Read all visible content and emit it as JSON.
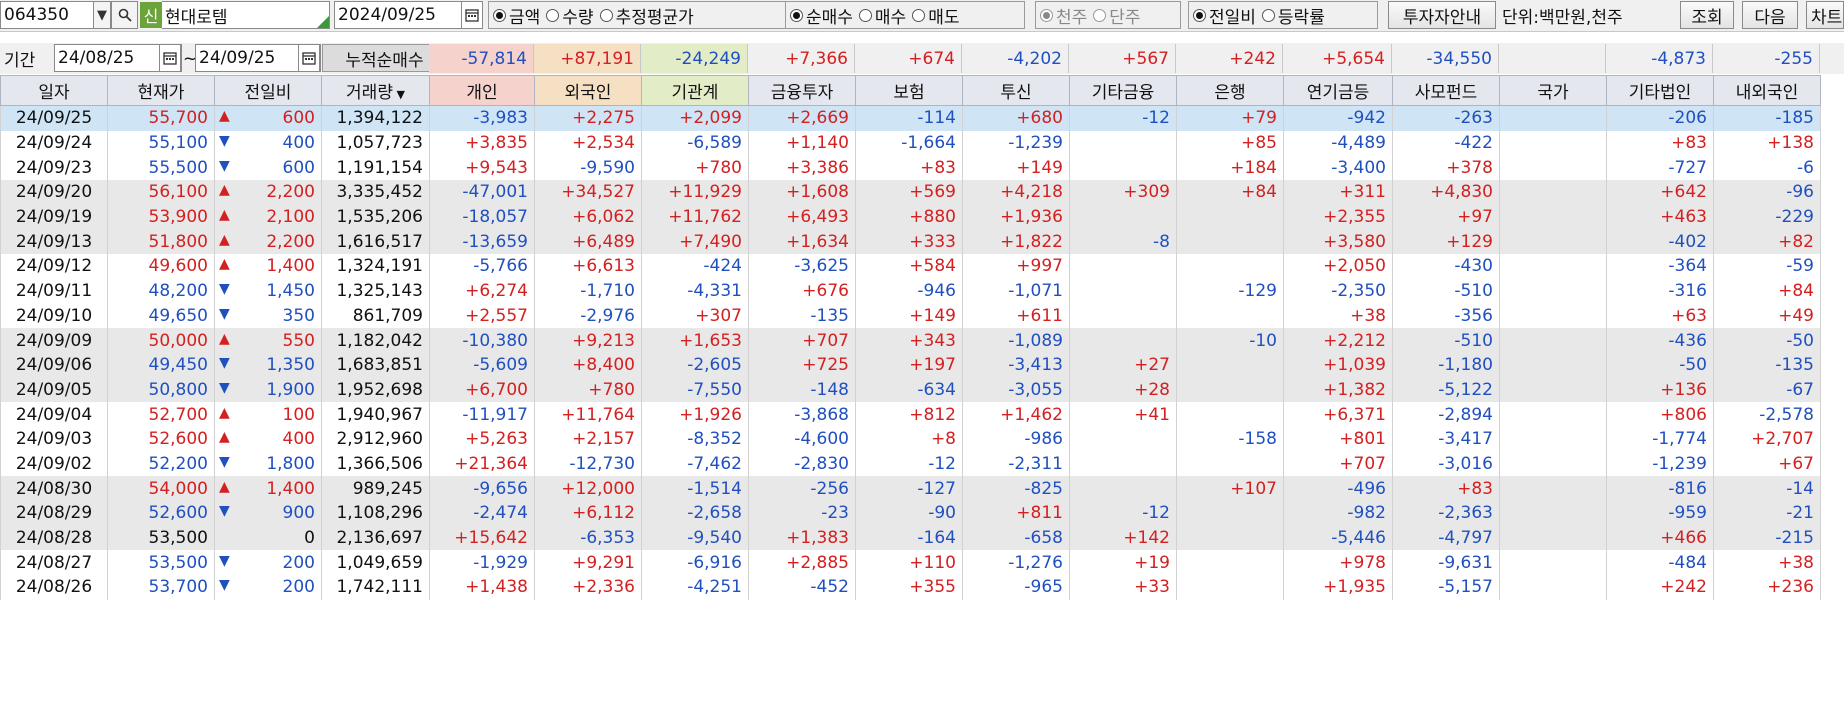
{
  "toolbar": {
    "code": "064350",
    "new_badge": "신",
    "name": "현대로템",
    "date": "2024/09/25",
    "unit_options": [
      "금액",
      "수량",
      "추정평균가"
    ],
    "trade_options": [
      "순매수",
      "매수",
      "매도"
    ],
    "scale_options": [
      "천주",
      "단주"
    ],
    "compare_options": [
      "전일비",
      "등락률"
    ],
    "investor_guide": "투자자안내",
    "units_label": "단위:백만원,천주",
    "search_btn": "조회",
    "next_btn": "다음",
    "chart_btn": "차트"
  },
  "period": {
    "label": "기간",
    "from": "24/08/25",
    "tilde": "~",
    "to": "24/09/25",
    "cum_label": "누적순매수"
  },
  "cumulative": [
    "-57,814",
    "+87,191",
    "-24,249",
    "+7,366",
    "+674",
    "-4,202",
    "+567",
    "+242",
    "+5,654",
    "-34,550",
    "",
    "-4,873",
    "-255"
  ],
  "columns": [
    "일자",
    "현재가",
    "전일비",
    "거래량",
    "개인",
    "외국인",
    "기관계",
    "금융투자",
    "보험",
    "투신",
    "기타금융",
    "은행",
    "연기금등",
    "사모펀드",
    "국가",
    "기타법인",
    "내외국인"
  ],
  "colors": {
    "up": "#d42020",
    "down": "#2050c0",
    "personal_bg": "#f6d2cc",
    "foreign_bg": "#f6e0c4",
    "inst_bg": "#e2ecc6"
  },
  "rows": [
    [
      "24/09/25",
      "55,700",
      "up",
      "600",
      "1,394,122",
      "-3,983",
      "+2,275",
      "+2,099",
      "+2,669",
      "-114",
      "+680",
      "-12",
      "+79",
      "-942",
      "-263",
      "",
      "-206",
      "-185"
    ],
    [
      "24/09/24",
      "55,100",
      "dn",
      "400",
      "1,057,723",
      "+3,835",
      "+2,534",
      "-6,589",
      "+1,140",
      "-1,664",
      "-1,239",
      "",
      "+85",
      "-4,489",
      "-422",
      "",
      "+83",
      "+138"
    ],
    [
      "24/09/23",
      "55,500",
      "dn",
      "600",
      "1,191,154",
      "+9,543",
      "-9,590",
      "+780",
      "+3,386",
      "+83",
      "+149",
      "",
      "+184",
      "-3,400",
      "+378",
      "",
      "-727",
      "-6"
    ],
    [
      "24/09/20",
      "56,100",
      "up",
      "2,200",
      "3,335,452",
      "-47,001",
      "+34,527",
      "+11,929",
      "+1,608",
      "+569",
      "+4,218",
      "+309",
      "+84",
      "+311",
      "+4,830",
      "",
      "+642",
      "-96"
    ],
    [
      "24/09/19",
      "53,900",
      "up",
      "2,100",
      "1,535,206",
      "-18,057",
      "+6,062",
      "+11,762",
      "+6,493",
      "+880",
      "+1,936",
      "",
      "",
      "+2,355",
      "+97",
      "",
      "+463",
      "-229"
    ],
    [
      "24/09/13",
      "51,800",
      "up",
      "2,200",
      "1,616,517",
      "-13,659",
      "+6,489",
      "+7,490",
      "+1,634",
      "+333",
      "+1,822",
      "-8",
      "",
      "+3,580",
      "+129",
      "",
      "-402",
      "+82"
    ],
    [
      "24/09/12",
      "49,600",
      "up",
      "1,400",
      "1,324,191",
      "-5,766",
      "+6,613",
      "-424",
      "-3,625",
      "+584",
      "+997",
      "",
      "",
      "+2,050",
      "-430",
      "",
      "-364",
      "-59"
    ],
    [
      "24/09/11",
      "48,200",
      "dn",
      "1,450",
      "1,325,143",
      "+6,274",
      "-1,710",
      "-4,331",
      "+676",
      "-946",
      "-1,071",
      "",
      "-129",
      "-2,350",
      "-510",
      "",
      "-316",
      "+84"
    ],
    [
      "24/09/10",
      "49,650",
      "dn",
      "350",
      "861,709",
      "+2,557",
      "-2,976",
      "+307",
      "-135",
      "+149",
      "+611",
      "",
      "",
      "+38",
      "-356",
      "",
      "+63",
      "+49"
    ],
    [
      "24/09/09",
      "50,000",
      "up",
      "550",
      "1,182,042",
      "-10,380",
      "+9,213",
      "+1,653",
      "+707",
      "+343",
      "-1,089",
      "",
      "-10",
      "+2,212",
      "-510",
      "",
      "-436",
      "-50"
    ],
    [
      "24/09/06",
      "49,450",
      "dn",
      "1,350",
      "1,683,851",
      "-5,609",
      "+8,400",
      "-2,605",
      "+725",
      "+197",
      "-3,413",
      "+27",
      "",
      "+1,039",
      "-1,180",
      "",
      "-50",
      "-135"
    ],
    [
      "24/09/05",
      "50,800",
      "dn",
      "1,900",
      "1,952,698",
      "+6,700",
      "+780",
      "-7,550",
      "-148",
      "-634",
      "-3,055",
      "+28",
      "",
      "+1,382",
      "-5,122",
      "",
      "+136",
      "-67"
    ],
    [
      "24/09/04",
      "52,700",
      "up",
      "100",
      "1,940,967",
      "-11,917",
      "+11,764",
      "+1,926",
      "-3,868",
      "+812",
      "+1,462",
      "+41",
      "",
      "+6,371",
      "-2,894",
      "",
      "+806",
      "-2,578"
    ],
    [
      "24/09/03",
      "52,600",
      "up",
      "400",
      "2,912,960",
      "+5,263",
      "+2,157",
      "-8,352",
      "-4,600",
      "+8",
      "-986",
      "",
      "-158",
      "+801",
      "-3,417",
      "",
      "-1,774",
      "+2,707"
    ],
    [
      "24/09/02",
      "52,200",
      "dn",
      "1,800",
      "1,366,506",
      "+21,364",
      "-12,730",
      "-7,462",
      "-2,830",
      "-12",
      "-2,311",
      "",
      "",
      "+707",
      "-3,016",
      "",
      "-1,239",
      "+67"
    ],
    [
      "24/08/30",
      "54,000",
      "up",
      "1,400",
      "989,245",
      "-9,656",
      "+12,000",
      "-1,514",
      "-256",
      "-127",
      "-825",
      "",
      "+107",
      "-496",
      "+83",
      "",
      "-816",
      "-14"
    ],
    [
      "24/08/29",
      "52,600",
      "dn",
      "900",
      "1,108,296",
      "-2,474",
      "+6,112",
      "-2,658",
      "-23",
      "-90",
      "+811",
      "-12",
      "",
      "-982",
      "-2,363",
      "",
      "-959",
      "-21"
    ],
    [
      "24/08/28",
      "53,500",
      "flat",
      "0",
      "2,136,697",
      "+15,642",
      "-6,353",
      "-9,540",
      "+1,383",
      "-164",
      "-658",
      "+142",
      "",
      "-5,446",
      "-4,797",
      "",
      "+466",
      "-215"
    ],
    [
      "24/08/27",
      "53,500",
      "dn",
      "200",
      "1,049,659",
      "-1,929",
      "+9,291",
      "-6,916",
      "+2,885",
      "+110",
      "-1,276",
      "+19",
      "",
      "+978",
      "-9,631",
      "",
      "-484",
      "+38"
    ],
    [
      "24/08/26",
      "53,700",
      "dn",
      "200",
      "1,742,111",
      "+1,438",
      "+2,336",
      "-4,251",
      "-452",
      "+355",
      "-965",
      "+33",
      "",
      "+1,935",
      "-5,157",
      "",
      "+242",
      "+236"
    ]
  ]
}
